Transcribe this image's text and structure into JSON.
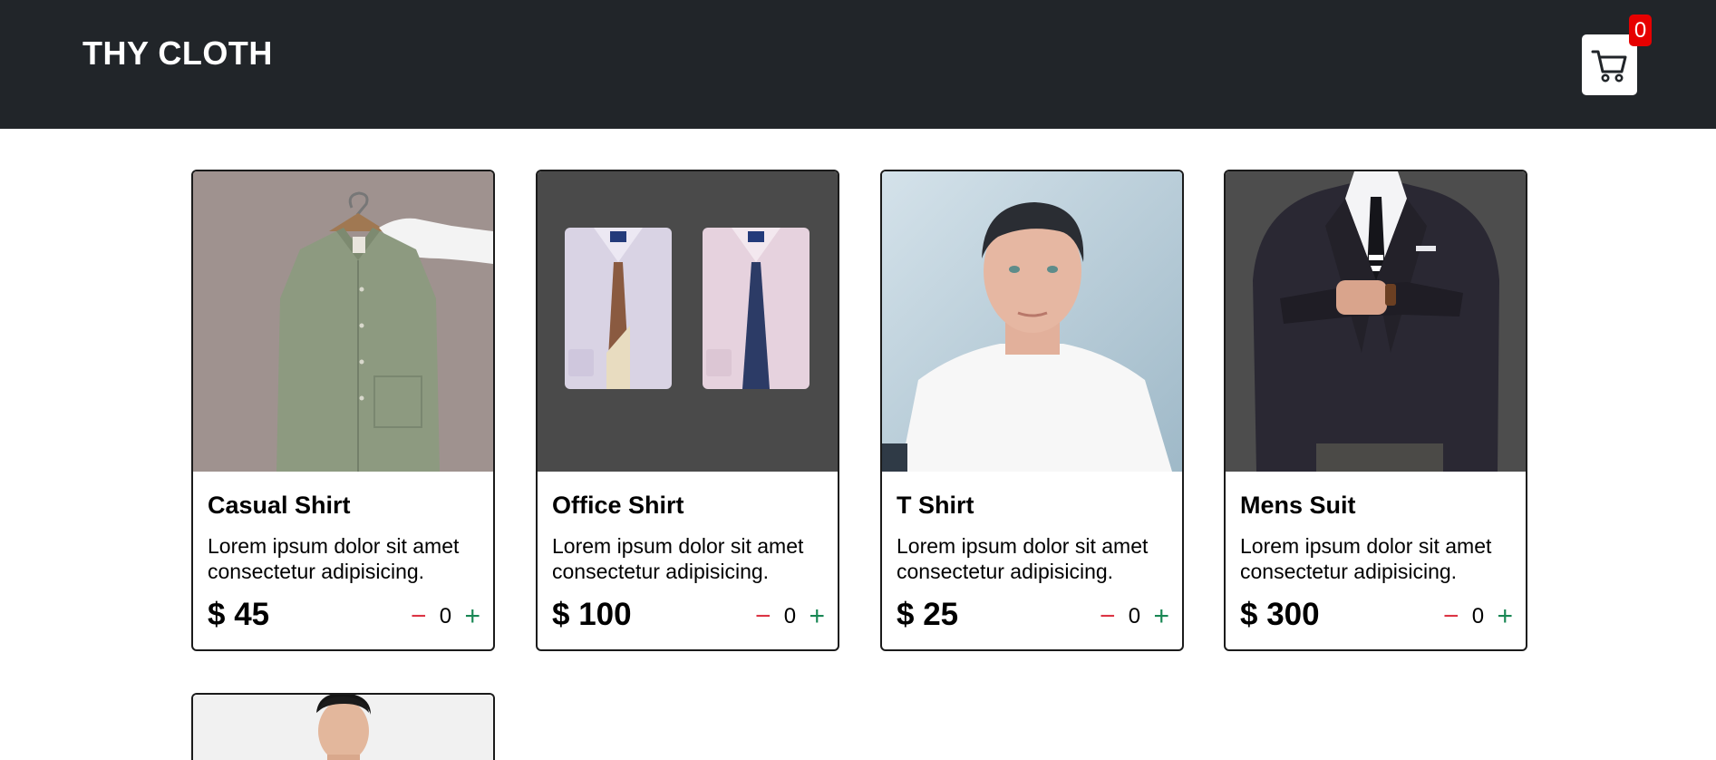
{
  "navbar": {
    "brand": "THY CLOTH",
    "cart_icon": "cart-icon",
    "cart_count": "0",
    "colors": {
      "background": "#212529",
      "badge": "#e60000"
    }
  },
  "products": [
    {
      "title": "Casual Shirt",
      "desc": "Lorem ipsum dolor sit amet consectetur adipisicing.",
      "price": "$ 45",
      "qty": "0",
      "minus": "−",
      "plus": "+"
    },
    {
      "title": "Office Shirt",
      "desc": "Lorem ipsum dolor sit amet consectetur adipisicing.",
      "price": "$ 100",
      "qty": "0",
      "minus": "−",
      "plus": "+"
    },
    {
      "title": "T Shirt",
      "desc": "Lorem ipsum dolor sit amet consectetur adipisicing.",
      "price": "$ 25",
      "qty": "0",
      "minus": "−",
      "plus": "+"
    },
    {
      "title": "Mens Suit",
      "desc": "Lorem ipsum dolor sit amet consectetur adipisicing.",
      "price": "$ 300",
      "qty": "0",
      "minus": "−",
      "plus": "+"
    },
    {
      "title": "",
      "desc": "",
      "price": "",
      "qty": ""
    }
  ]
}
